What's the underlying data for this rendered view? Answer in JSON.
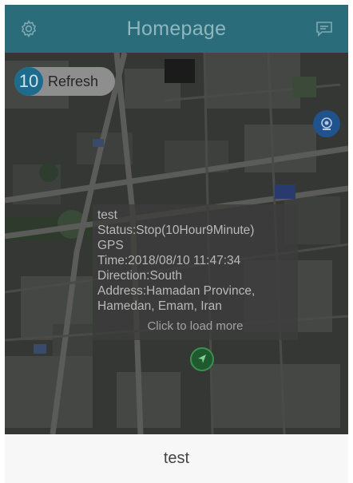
{
  "header": {
    "title": "Homepage",
    "left_icon": "gear-icon",
    "right_icon": "chat-icon",
    "bg_color": "#2a6c79"
  },
  "refresh": {
    "count": "10",
    "label": "Refresh"
  },
  "map": {
    "camera_icon": "camera-icon",
    "marker_icon": "navigation-arrow-icon"
  },
  "info_panel": {
    "name": "test",
    "status": "Status:Stop(10Hour9Minute)",
    "source": "GPS",
    "time": "Time:2018/08/10 11:47:34",
    "direction": "Direction:South",
    "address": "Address:Hamadan Province, Hamedan, Emam, Iran",
    "more": "Click to load more"
  },
  "footer": {
    "device_name": "test"
  }
}
